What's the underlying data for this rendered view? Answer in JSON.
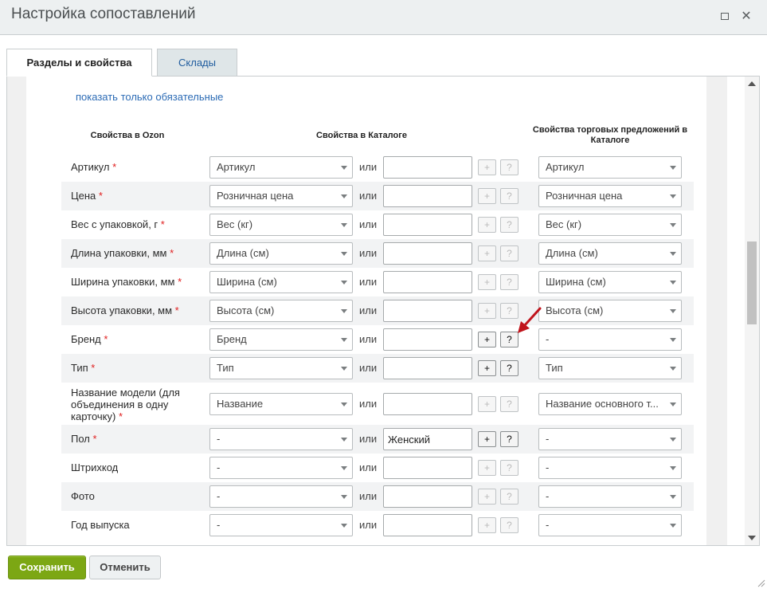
{
  "window": {
    "title": "Настройка сопоставлений"
  },
  "tabs": [
    {
      "label": "Разделы и свойства",
      "active": true
    },
    {
      "label": "Склады",
      "active": false
    }
  ],
  "filter_link": "показать только обязательные",
  "columns": {
    "ozon": "Свойства в Ozon",
    "catalog": "Свойства в Каталоге",
    "offers": "Свойства торговых предложений в Каталоге"
  },
  "or_label": "или",
  "plus_label": "+",
  "help_label": "?",
  "rows": [
    {
      "label": "Артикул",
      "required": true,
      "catalog": "Артикул",
      "text": "",
      "buttons_active": false,
      "offer": "Артикул"
    },
    {
      "label": "Цена",
      "required": true,
      "catalog": "Розничная цена",
      "text": "",
      "buttons_active": false,
      "offer": "Розничная цена"
    },
    {
      "label": "Вес с упаковкой, г",
      "required": true,
      "catalog": "Вес (кг)",
      "text": "",
      "buttons_active": false,
      "offer": "Вес (кг)"
    },
    {
      "label": "Длина упаковки, мм",
      "required": true,
      "catalog": "Длина (см)",
      "text": "",
      "buttons_active": false,
      "offer": "Длина (см)"
    },
    {
      "label": "Ширина упаковки, мм",
      "required": true,
      "catalog": "Ширина (см)",
      "text": "",
      "buttons_active": false,
      "offer": "Ширина (см)"
    },
    {
      "label": "Высота упаковки, мм",
      "required": true,
      "catalog": "Высота (см)",
      "text": "",
      "buttons_active": false,
      "offer": "Высота (см)"
    },
    {
      "label": "Бренд",
      "required": true,
      "catalog": "Бренд",
      "text": "",
      "buttons_active": true,
      "offer": "-"
    },
    {
      "label": "Тип",
      "required": true,
      "catalog": "Тип",
      "text": "",
      "buttons_active": true,
      "offer": "Тип"
    },
    {
      "label": "Название модели (для объединения в одну карточку)",
      "required": true,
      "catalog": "Название",
      "text": "",
      "buttons_active": false,
      "offer": "Название основного т..."
    },
    {
      "label": "Пол",
      "required": true,
      "catalog": "-",
      "text": "Женский",
      "buttons_active": true,
      "offer": "-"
    },
    {
      "label": "Штрихкод",
      "required": false,
      "catalog": "-",
      "text": "",
      "buttons_active": false,
      "offer": "-"
    },
    {
      "label": "Фото",
      "required": false,
      "catalog": "-",
      "text": "",
      "buttons_active": false,
      "offer": "-"
    },
    {
      "label": "Год выпуска",
      "required": false,
      "catalog": "-",
      "text": "",
      "buttons_active": false,
      "offer": "-"
    }
  ],
  "footer": {
    "save": "Сохранить",
    "cancel": "Отменить"
  },
  "colors": {
    "accent_link": "#2c6bb5",
    "save_button": "#7ca714",
    "required_mark": "#e02020",
    "annotation_arrow": "#c0141c"
  }
}
